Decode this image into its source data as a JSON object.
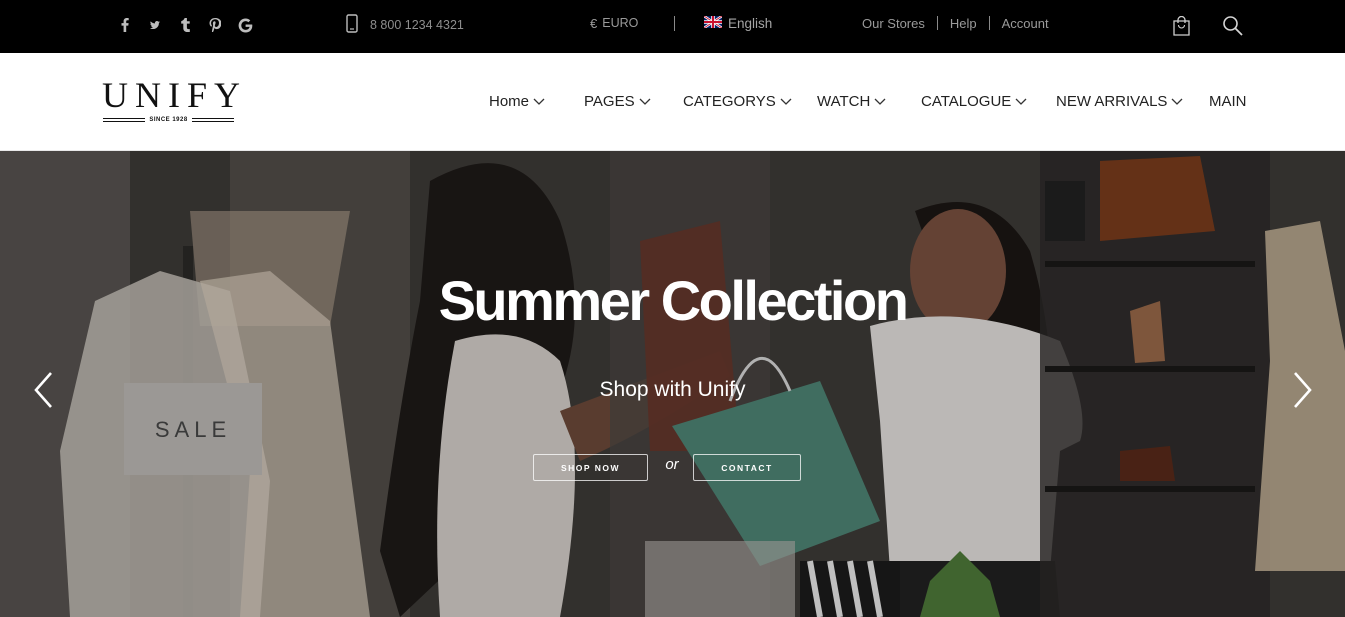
{
  "topbar": {
    "social": [
      {
        "name": "facebook-icon"
      },
      {
        "name": "twitter-icon"
      },
      {
        "name": "tumblr-icon"
      },
      {
        "name": "pinterest-icon"
      },
      {
        "name": "google-icon"
      }
    ],
    "phone": "8 800 1234 4321",
    "currency_symbol": "€",
    "currency": "EURO",
    "language": "English",
    "links": [
      "Our Stores",
      "Help",
      "Account"
    ]
  },
  "header": {
    "logo_text": "UNIFY",
    "logo_since": "SINCE 1928",
    "nav": [
      {
        "label": "Home",
        "dropdown": true
      },
      {
        "label": "PAGES",
        "dropdown": true
      },
      {
        "label": "CATEGORYS",
        "dropdown": true
      },
      {
        "label": "WATCH",
        "dropdown": true
      },
      {
        "label": "CATALOGUE",
        "dropdown": true
      },
      {
        "label": "NEW ARRIVALS",
        "dropdown": true
      },
      {
        "label": "MAIN",
        "dropdown": false
      }
    ]
  },
  "hero": {
    "title": "Summer Collection",
    "subtitle": "Shop with Unify",
    "primary_button": "SHOP NOW",
    "or_text": "or",
    "secondary_button": "CONTACT",
    "sign_text": "SALE"
  },
  "colors": {
    "topbar_bg": "#000000",
    "header_bg": "#ffffff",
    "hero_text": "#ffffff"
  }
}
